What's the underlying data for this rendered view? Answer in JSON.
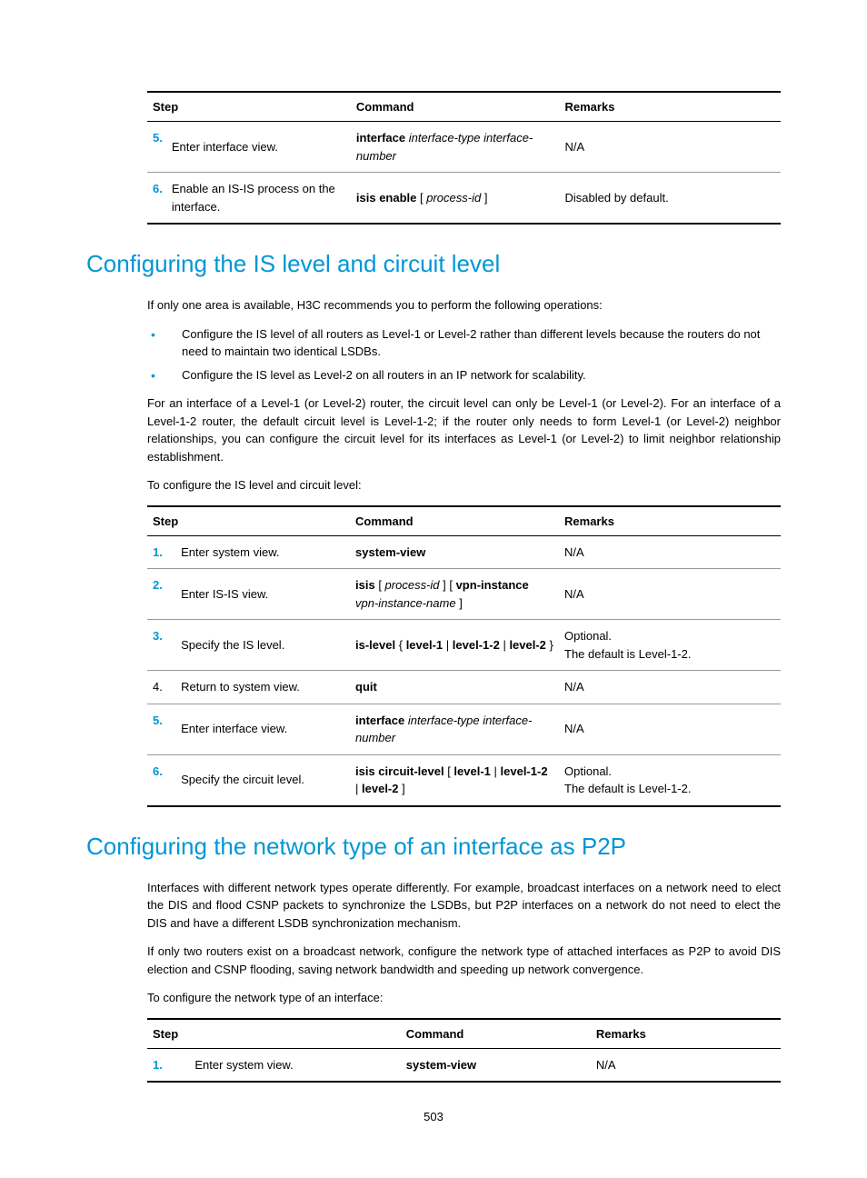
{
  "table1": {
    "headers": {
      "step": "Step",
      "command": "Command",
      "remarks": "Remarks"
    },
    "rows": [
      {
        "num": "5.",
        "desc": "Enter interface view.",
        "cmd_parts": [
          {
            "t": "interface ",
            "b": true
          },
          {
            "t": "interface-type interface-number",
            "i": true
          }
        ],
        "remarks": "N/A"
      },
      {
        "num": "6.",
        "desc": "Enable an IS-IS process on the interface.",
        "cmd_parts": [
          {
            "t": "isis enable ",
            "b": true
          },
          {
            "t": "[ "
          },
          {
            "t": "process-id",
            "i": true
          },
          {
            "t": " ]"
          }
        ],
        "remarks": "Disabled by default."
      }
    ]
  },
  "section1": {
    "heading": "Configuring the IS level and circuit level",
    "intro": "If only one area is available, H3C recommends you to perform the following operations:",
    "bullets": [
      "Configure the IS level of all routers as Level-1 or Level-2 rather than different levels because the routers do not need to maintain two identical LSDBs.",
      "Configure the IS level as Level-2 on all routers in an IP network for scalability."
    ],
    "para2": "For an interface of a Level-1 (or Level-2) router, the circuit level can only be Level-1 (or Level-2). For an interface of a Level-1-2 router, the default circuit level is Level-1-2; if the router only needs to form Level-1 (or Level-2) neighbor relationships, you can configure the circuit level for its interfaces as Level-1 (or Level-2) to limit neighbor relationship establishment.",
    "para3": "To configure the IS level and circuit level:"
  },
  "table2": {
    "headers": {
      "step": "Step",
      "command": "Command",
      "remarks": "Remarks"
    },
    "rows": [
      {
        "num": "1.",
        "blue": true,
        "desc": "Enter system view.",
        "cmd_parts": [
          {
            "t": "system-view",
            "b": true
          }
        ],
        "remarks_lines": [
          "N/A"
        ]
      },
      {
        "num": "2.",
        "blue": true,
        "desc": "Enter IS-IS view.",
        "cmd_parts": [
          {
            "t": "isis ",
            "b": true
          },
          {
            "t": "[ "
          },
          {
            "t": "process-id",
            "i": true
          },
          {
            "t": " ] [ "
          },
          {
            "t": "vpn-instance",
            "b": true
          },
          {
            "t": " "
          },
          {
            "t": "vpn-instance-name",
            "i": true
          },
          {
            "t": " ]"
          }
        ],
        "remarks_lines": [
          "N/A"
        ]
      },
      {
        "num": "3.",
        "blue": true,
        "desc": "Specify the IS level.",
        "cmd_parts": [
          {
            "t": "is-level ",
            "b": true
          },
          {
            "t": "{ "
          },
          {
            "t": "level-1",
            "b": true
          },
          {
            "t": " | "
          },
          {
            "t": "level-1-2",
            "b": true
          },
          {
            "t": " | "
          },
          {
            "t": "level-2",
            "b": true
          },
          {
            "t": " }"
          }
        ],
        "remarks_lines": [
          "Optional.",
          "The default is Level-1-2."
        ]
      },
      {
        "num": "4.",
        "blue": false,
        "desc": "Return to system view.",
        "cmd_parts": [
          {
            "t": "quit",
            "b": true
          }
        ],
        "remarks_lines": [
          "N/A"
        ]
      },
      {
        "num": "5.",
        "blue": true,
        "desc": "Enter interface view.",
        "cmd_parts": [
          {
            "t": "interface ",
            "b": true
          },
          {
            "t": "interface-type interface-number",
            "i": true
          }
        ],
        "remarks_lines": [
          "N/A"
        ]
      },
      {
        "num": "6.",
        "blue": true,
        "desc": "Specify the circuit level.",
        "cmd_parts": [
          {
            "t": "isis circuit-level ",
            "b": true
          },
          {
            "t": "[ "
          },
          {
            "t": "level-1",
            "b": true
          },
          {
            "t": " | "
          },
          {
            "t": "level-1-2",
            "b": true
          },
          {
            "t": " | "
          },
          {
            "t": "level-2",
            "b": true
          },
          {
            "t": " ]"
          }
        ],
        "remarks_lines": [
          "Optional.",
          "The default is Level-1-2."
        ]
      }
    ]
  },
  "section2": {
    "heading": "Configuring the network type of an interface as P2P",
    "para1": "Interfaces with different network types operate differently. For example, broadcast interfaces on a network need to elect the DIS and flood CSNP packets to synchronize the LSDBs, but P2P interfaces on a network do not need to elect the DIS and have a different LSDB synchronization mechanism.",
    "para2": "If only two routers exist on a broadcast network, configure the network type of attached interfaces as P2P to avoid DIS election and CSNP flooding, saving network bandwidth and speeding up network convergence.",
    "para3": "To configure the network type of an interface:"
  },
  "table3": {
    "headers": {
      "step": "Step",
      "command": "Command",
      "remarks": "Remarks"
    },
    "rows": [
      {
        "num": "1.",
        "blue": true,
        "desc": "Enter system view.",
        "cmd_parts": [
          {
            "t": "system-view",
            "b": true
          }
        ],
        "remarks_lines": [
          "N/A"
        ]
      }
    ]
  },
  "page_number": "503"
}
